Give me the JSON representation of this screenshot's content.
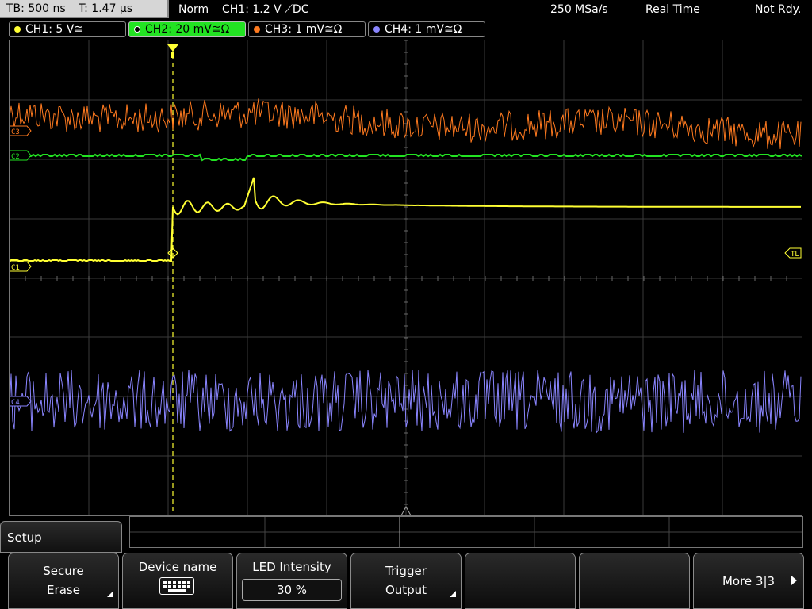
{
  "topbar": {
    "timebase": "TB: 500 ns",
    "trigger_time": "T: 1.47 µs",
    "mode": "Norm",
    "trigger_info": "CH1: 1.2 V ⟋DC",
    "sample_rate": "250 MSa/s",
    "acq_mode": "Real Time",
    "status": "Not Rdy."
  },
  "channels": [
    {
      "label": "CH1: 5 V≅",
      "color": "#ffff33"
    },
    {
      "label": "CH2: 20 mV≅Ω",
      "color": "#22e322"
    },
    {
      "label": "CH3: 1 mV≅Ω",
      "color": "#ff7a1f"
    },
    {
      "label": "CH4: 1 mV≅Ω",
      "color": "#8a85ff"
    }
  ],
  "markers": {
    "c3": "C3",
    "c2": "C2",
    "c1": "C1",
    "c4": "C4",
    "trigger_level": "TL"
  },
  "menu": {
    "title": "Setup",
    "keys": {
      "secure_erase": {
        "line1": "Secure",
        "line2": "Erase"
      },
      "device_name": {
        "line1": "Device name"
      },
      "led_intensity": {
        "line1": "LED Intensity",
        "value": "30 %"
      },
      "trigger_output": {
        "line1": "Trigger",
        "line2": "Output"
      },
      "more": {
        "line1": "More 3|3"
      }
    }
  }
}
